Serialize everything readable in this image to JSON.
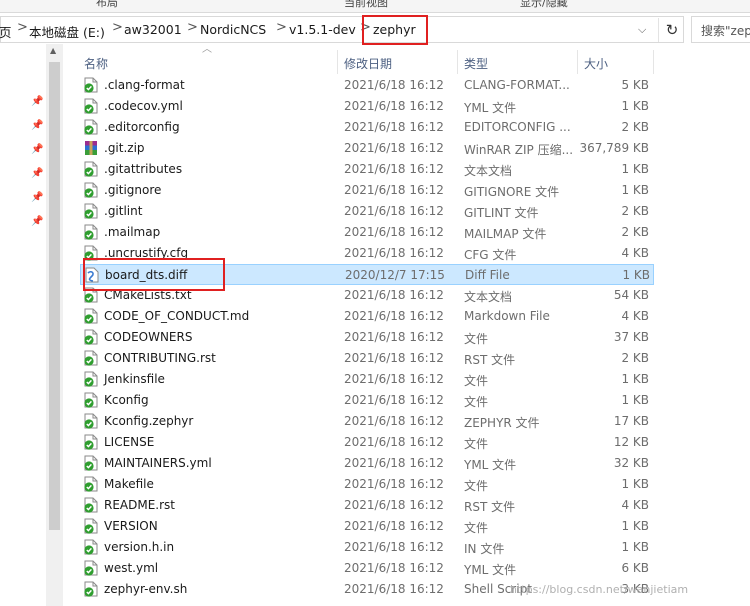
{
  "ribbon": {
    "layout": "布局",
    "current_view": "当前视图",
    "show_hide": "显示/隐藏"
  },
  "address": {
    "crumbs": [
      "页",
      "本地磁盘 (E:)",
      "aw32001",
      "NordicNCS",
      "v1.5.1-dev",
      "zephyr"
    ],
    "separator": ">",
    "dropdown": "⌵",
    "refresh": "↻"
  },
  "search": {
    "placeholder": "搜索\"zephyr\""
  },
  "columns": {
    "name": "名称",
    "date": "修改日期",
    "type": "类型",
    "size": "大小"
  },
  "accent": {
    "highlight": "#e02020",
    "selected": "#cce8ff"
  },
  "files": [
    {
      "name": ".clang-format",
      "date": "2021/6/18 16:12",
      "type": "CLANG-FORMAT...",
      "size": "5 KB",
      "icon": "checked-file-icon"
    },
    {
      "name": ".codecov.yml",
      "date": "2021/6/18 16:12",
      "type": "YML 文件",
      "size": "1 KB",
      "icon": "checked-file-icon"
    },
    {
      "name": ".editorconfig",
      "date": "2021/6/18 16:12",
      "type": "EDITORCONFIG ...",
      "size": "2 KB",
      "icon": "checked-file-icon"
    },
    {
      "name": ".git.zip",
      "date": "2021/6/18 16:12",
      "type": "WinRAR ZIP 压缩...",
      "size": "367,789 KB",
      "icon": "winrar-icon"
    },
    {
      "name": ".gitattributes",
      "date": "2021/6/18 16:12",
      "type": "文本文档",
      "size": "1 KB",
      "icon": "checked-file-icon"
    },
    {
      "name": ".gitignore",
      "date": "2021/6/18 16:12",
      "type": "GITIGNORE 文件",
      "size": "1 KB",
      "icon": "checked-file-icon"
    },
    {
      "name": ".gitlint",
      "date": "2021/6/18 16:12",
      "type": "GITLINT 文件",
      "size": "2 KB",
      "icon": "checked-file-icon"
    },
    {
      "name": ".mailmap",
      "date": "2021/6/18 16:12",
      "type": "MAILMAP 文件",
      "size": "2 KB",
      "icon": "checked-file-icon"
    },
    {
      "name": ".uncrustify.cfg",
      "date": "2021/6/18 16:12",
      "type": "CFG 文件",
      "size": "4 KB",
      "icon": "checked-file-icon"
    },
    {
      "name": "board_dts.diff",
      "date": "2020/12/7 17:15",
      "type": "Diff File",
      "size": "1 KB",
      "icon": "diff-file-icon",
      "selected": true
    },
    {
      "name": "CMakeLists.txt",
      "date": "2021/6/18 16:12",
      "type": "文本文档",
      "size": "54 KB",
      "icon": "checked-file-icon"
    },
    {
      "name": "CODE_OF_CONDUCT.md",
      "date": "2021/6/18 16:12",
      "type": "Markdown File",
      "size": "4 KB",
      "icon": "checked-file-icon"
    },
    {
      "name": "CODEOWNERS",
      "date": "2021/6/18 16:12",
      "type": "文件",
      "size": "37 KB",
      "icon": "checked-file-icon"
    },
    {
      "name": "CONTRIBUTING.rst",
      "date": "2021/6/18 16:12",
      "type": "RST 文件",
      "size": "2 KB",
      "icon": "checked-file-icon"
    },
    {
      "name": "Jenkinsfile",
      "date": "2021/6/18 16:12",
      "type": "文件",
      "size": "1 KB",
      "icon": "checked-file-icon"
    },
    {
      "name": "Kconfig",
      "date": "2021/6/18 16:12",
      "type": "文件",
      "size": "1 KB",
      "icon": "checked-file-icon"
    },
    {
      "name": "Kconfig.zephyr",
      "date": "2021/6/18 16:12",
      "type": "ZEPHYR 文件",
      "size": "17 KB",
      "icon": "checked-file-icon"
    },
    {
      "name": "LICENSE",
      "date": "2021/6/18 16:12",
      "type": "文件",
      "size": "12 KB",
      "icon": "checked-file-icon"
    },
    {
      "name": "MAINTAINERS.yml",
      "date": "2021/6/18 16:12",
      "type": "YML 文件",
      "size": "32 KB",
      "icon": "checked-file-icon"
    },
    {
      "name": "Makefile",
      "date": "2021/6/18 16:12",
      "type": "文件",
      "size": "1 KB",
      "icon": "checked-file-icon"
    },
    {
      "name": "README.rst",
      "date": "2021/6/18 16:12",
      "type": "RST 文件",
      "size": "4 KB",
      "icon": "checked-file-icon"
    },
    {
      "name": "VERSION",
      "date": "2021/6/18 16:12",
      "type": "文件",
      "size": "1 KB",
      "icon": "checked-file-icon"
    },
    {
      "name": "version.h.in",
      "date": "2021/6/18 16:12",
      "type": "IN 文件",
      "size": "1 KB",
      "icon": "checked-file-icon"
    },
    {
      "name": "west.yml",
      "date": "2021/6/18 16:12",
      "type": "YML 文件",
      "size": "6 KB",
      "icon": "checked-file-icon"
    },
    {
      "name": "zephyr-env.sh",
      "date": "2021/6/18 16:12",
      "type": "Shell Script",
      "size": "3 KB",
      "icon": "checked-file-icon"
    }
  ],
  "watermark": "https://blog.csdn.net/wanjietiam"
}
